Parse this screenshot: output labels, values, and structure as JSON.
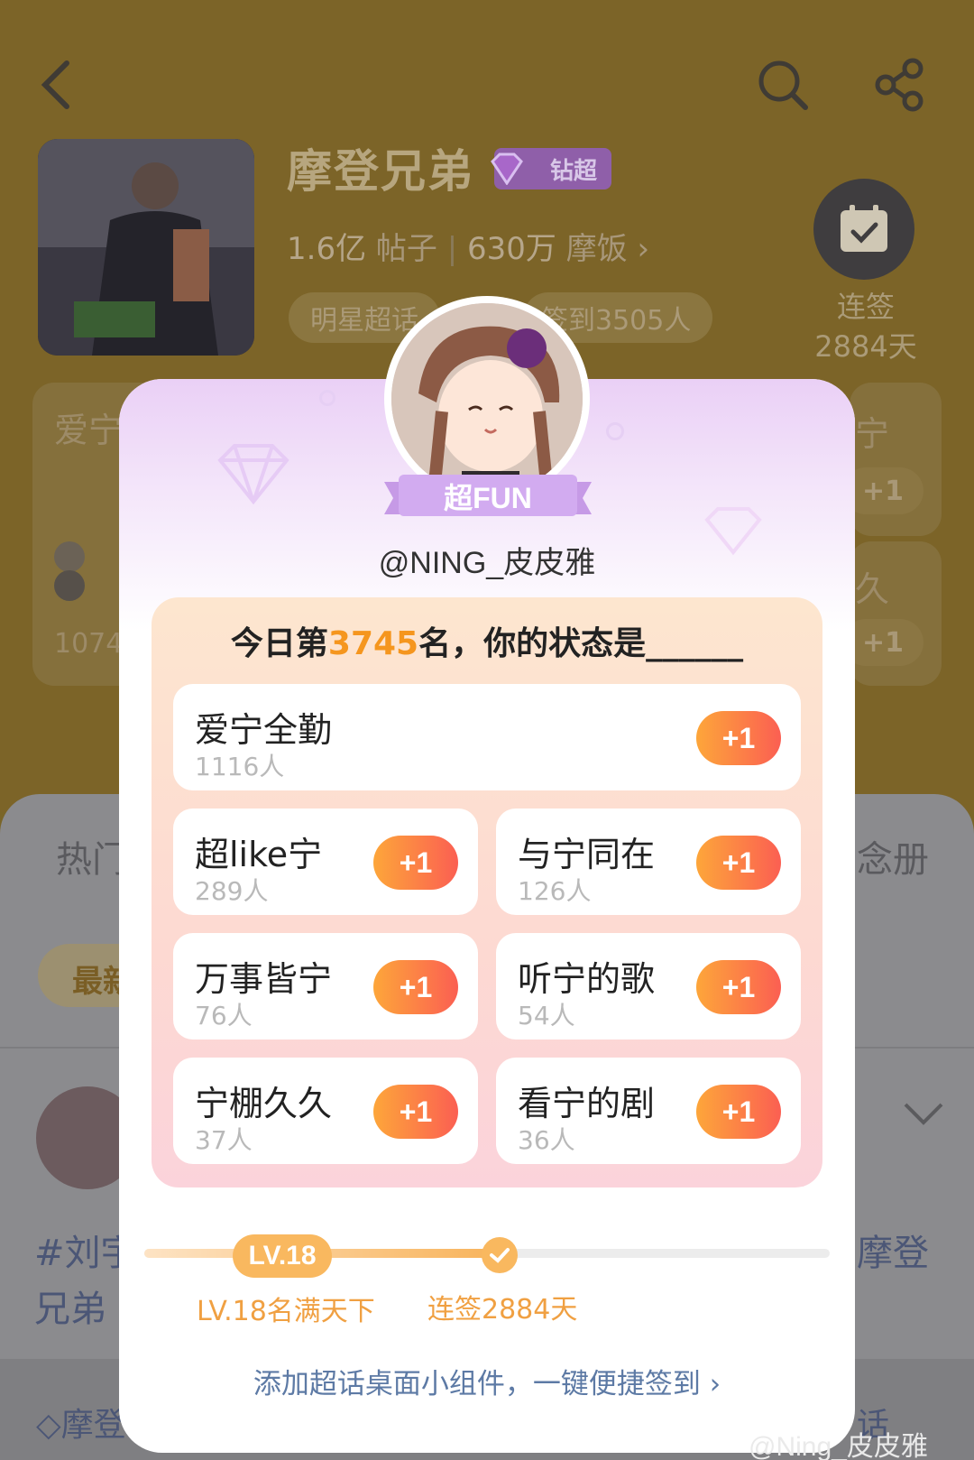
{
  "header": {
    "community_name": "摩登兄弟",
    "diamond_badge": "钻超",
    "posts_count": "1.6亿",
    "posts_label": "帖子",
    "fans_count": "630万",
    "fans_label": "摩饭",
    "tags": [
      "明星超话",
      "签到3505人"
    ],
    "checkin_label": "连签",
    "checkin_days": "2884天"
  },
  "background": {
    "left_card_title": "爱宁",
    "left_card_count": "1074",
    "right_card_title_1": "宁",
    "right_card_title_2": "久",
    "plus_one": "+1",
    "sheet_tab_left": "热门",
    "sheet_tab_right": "念册",
    "sheet_chip": "最新",
    "post_hashtag_1": "#刘宇",
    "post_hashtag_2": "兄弟",
    "post_right_text": "摩登",
    "footer_community": "摩登",
    "footer_right": "话"
  },
  "modal": {
    "tier_badge": "超FUN",
    "username": "@NING_皮皮雅",
    "rank_prefix": "今日第",
    "rank_number": "3745",
    "rank_suffix": "名，你的状态是______",
    "options": [
      {
        "name": "爱宁全勤",
        "count": "1116人",
        "button": "+1"
      },
      {
        "name": "超like宁",
        "count": "289人",
        "button": "+1"
      },
      {
        "name": "与宁同在",
        "count": "126人",
        "button": "+1"
      },
      {
        "name": "万事皆宁",
        "count": "76人",
        "button": "+1"
      },
      {
        "name": "听宁的歌",
        "count": "54人",
        "button": "+1"
      },
      {
        "name": "宁棚久久",
        "count": "37人",
        "button": "+1"
      },
      {
        "name": "看宁的剧",
        "count": "36人",
        "button": "+1"
      }
    ],
    "level_pill": "LV.18",
    "level_label": "LV.18名满天下",
    "streak_label": "连签2884天",
    "widget_link": "添加超话桌面小组件，一键便捷签到"
  },
  "watermark": "@Ning_皮皮雅",
  "colors": {
    "accent_orange": "#f5961e",
    "button_gradient_start": "#fda63a",
    "button_gradient_end": "#fb5f52",
    "link_blue": "#5d7aa5",
    "level_orange": "#f9b85f"
  }
}
